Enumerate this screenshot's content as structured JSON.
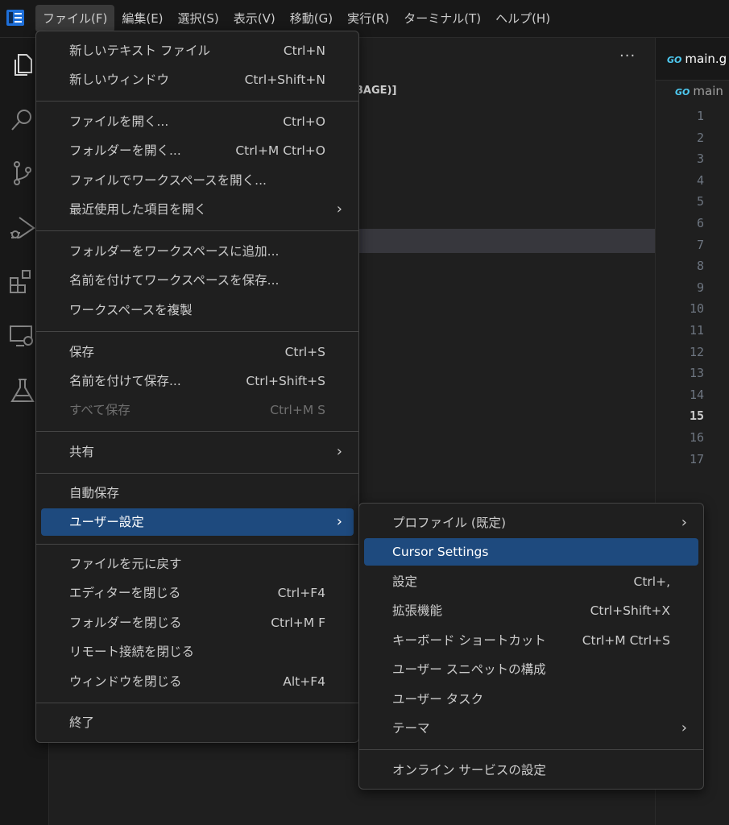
{
  "menubar": {
    "items": [
      "ファイル(F)",
      "編集(E)",
      "選択(S)",
      "表示(V)",
      "移動(G)",
      "実行(R)",
      "ターミナル(T)",
      "ヘルプ(H)"
    ]
  },
  "sidebar": {
    "more_label": "···",
    "header_fragment": "BAGE)]"
  },
  "editor": {
    "tab_icon": "GO",
    "tab_label": "main.g",
    "breadcrumb_label": "main",
    "line_numbers": [
      "1",
      "2",
      "3",
      "4",
      "5",
      "6",
      "7",
      "8",
      "9",
      "10",
      "11",
      "12",
      "13",
      "14",
      "15",
      "16",
      "17"
    ],
    "current_line": "15"
  },
  "file_menu": {
    "items": [
      {
        "label": "新しいテキスト ファイル",
        "shortcut": "Ctrl+N"
      },
      {
        "label": "新しいウィンドウ",
        "shortcut": "Ctrl+Shift+N"
      },
      {
        "label": "ファイルを開く...",
        "shortcut": "Ctrl+O"
      },
      {
        "label": "フォルダーを開く...",
        "shortcut": "Ctrl+M Ctrl+O"
      },
      {
        "label": "ファイルでワークスペースを開く...",
        "shortcut": ""
      },
      {
        "label": "最近使用した項目を開く",
        "shortcut": ""
      },
      {
        "label": "フォルダーをワークスペースに追加...",
        "shortcut": ""
      },
      {
        "label": "名前を付けてワークスペースを保存...",
        "shortcut": ""
      },
      {
        "label": "ワークスペースを複製",
        "shortcut": ""
      },
      {
        "label": "保存",
        "shortcut": "Ctrl+S"
      },
      {
        "label": "名前を付けて保存...",
        "shortcut": "Ctrl+Shift+S"
      },
      {
        "label": "すべて保存",
        "shortcut": "Ctrl+M S"
      },
      {
        "label": "共有",
        "shortcut": ""
      },
      {
        "label": "自動保存",
        "shortcut": ""
      },
      {
        "label": "ユーザー設定",
        "shortcut": ""
      },
      {
        "label": "ファイルを元に戻す",
        "shortcut": ""
      },
      {
        "label": "エディターを閉じる",
        "shortcut": "Ctrl+F4"
      },
      {
        "label": "フォルダーを閉じる",
        "shortcut": "Ctrl+M F"
      },
      {
        "label": "リモート接続を閉じる",
        "shortcut": ""
      },
      {
        "label": "ウィンドウを閉じる",
        "shortcut": "Alt+F4"
      },
      {
        "label": "終了",
        "shortcut": ""
      }
    ]
  },
  "preferences_menu": {
    "items": [
      {
        "label": "プロファイル (既定)",
        "shortcut": ""
      },
      {
        "label": "Cursor Settings",
        "shortcut": ""
      },
      {
        "label": "設定",
        "shortcut": "Ctrl+,"
      },
      {
        "label": "拡張機能",
        "shortcut": "Ctrl+Shift+X"
      },
      {
        "label": "キーボード ショートカット",
        "shortcut": "Ctrl+M Ctrl+S"
      },
      {
        "label": "ユーザー スニペットの構成",
        "shortcut": ""
      },
      {
        "label": "ユーザー タスク",
        "shortcut": ""
      },
      {
        "label": "テーマ",
        "shortcut": ""
      },
      {
        "label": "オンライン サービスの設定",
        "shortcut": ""
      }
    ]
  },
  "submenu_arrow": "›"
}
